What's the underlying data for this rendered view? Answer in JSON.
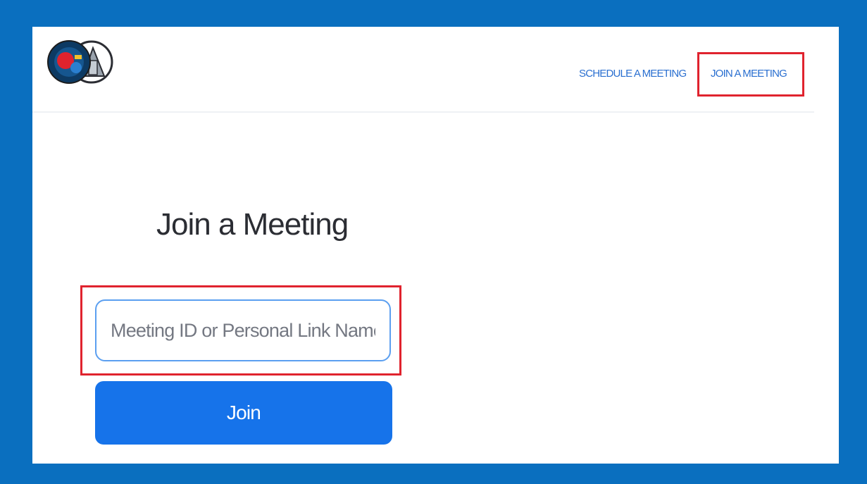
{
  "colors": {
    "frame": "#0a6fbf",
    "accent": "#1673ea",
    "link": "#2a6fd0",
    "highlight": "#e0232e"
  },
  "header": {
    "logo_icon": "zoom-seal-logo-icon",
    "nav": {
      "schedule_label": "SCHEDULE A MEETING",
      "join_label": "JOIN A MEETING"
    }
  },
  "main": {
    "title": "Join a Meeting",
    "meeting_input": {
      "value": "",
      "placeholder": "Meeting ID or Personal Link Name"
    },
    "join_button_label": "Join"
  }
}
